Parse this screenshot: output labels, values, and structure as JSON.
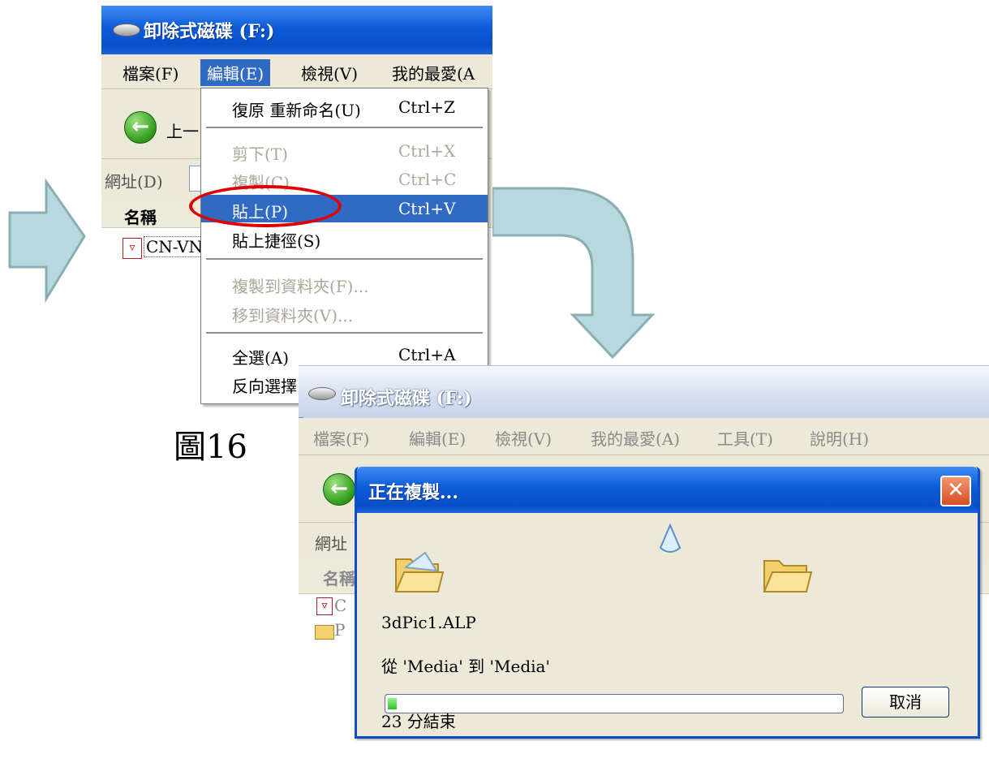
{
  "explorer_window_1": {
    "title": "卸除式磁碟 (F:)",
    "menu": [
      "檔案(F)",
      "編輯(E)",
      "檢視(V)",
      "我的最愛(A"
    ],
    "back_label": "上一",
    "address_label": "網址(D)",
    "list_header_name": "名稱",
    "file_item": "CN-VN"
  },
  "edit_menu": {
    "items": [
      {
        "label": "復原 重新命名(U)",
        "shortcut": "Ctrl+Z",
        "state": "enabled"
      },
      {
        "label": "剪下(T)",
        "shortcut": "Ctrl+X",
        "state": "disabled"
      },
      {
        "label": "複製(C)",
        "shortcut": "Ctrl+C",
        "state": "disabled"
      },
      {
        "label": "貼上(P)",
        "shortcut": "Ctrl+V",
        "state": "highlighted"
      },
      {
        "label": "貼上捷徑(S)",
        "shortcut": "",
        "state": "enabled"
      },
      {
        "label": "複製到資料夾(F)...",
        "shortcut": "",
        "state": "disabled"
      },
      {
        "label": "移到資料夾(V)...",
        "shortcut": "",
        "state": "disabled"
      },
      {
        "label": "全選(A)",
        "shortcut": "Ctrl+A",
        "state": "enabled"
      },
      {
        "label": "反向選擇",
        "shortcut": "",
        "state": "enabled"
      }
    ]
  },
  "caption": "圖16",
  "explorer_window_2": {
    "title": "卸除式磁碟 (F:)",
    "menu": [
      "檔案(F)",
      "編輯(E)",
      "檢視(V)",
      "我的最愛(A)",
      "工具(T)",
      "說明(H)"
    ],
    "address_label": "網址",
    "list_header_name": "名稱",
    "list_items": [
      "C",
      "P"
    ]
  },
  "copy_dialog": {
    "title": "正在複製...",
    "file_name": "3dPic1.ALP",
    "from_to": "從 'Media' 到 'Media'",
    "progress_fraction": 0.02,
    "time_remaining": "23 分結束",
    "cancel_label": "取消"
  },
  "colors": {
    "arrow_fill": "#b6d9de",
    "arrow_stroke": "#8aaeb2",
    "xp_blue": "#0c5bd8",
    "highlight": "#316ac5",
    "ellipse": "#e00000"
  }
}
